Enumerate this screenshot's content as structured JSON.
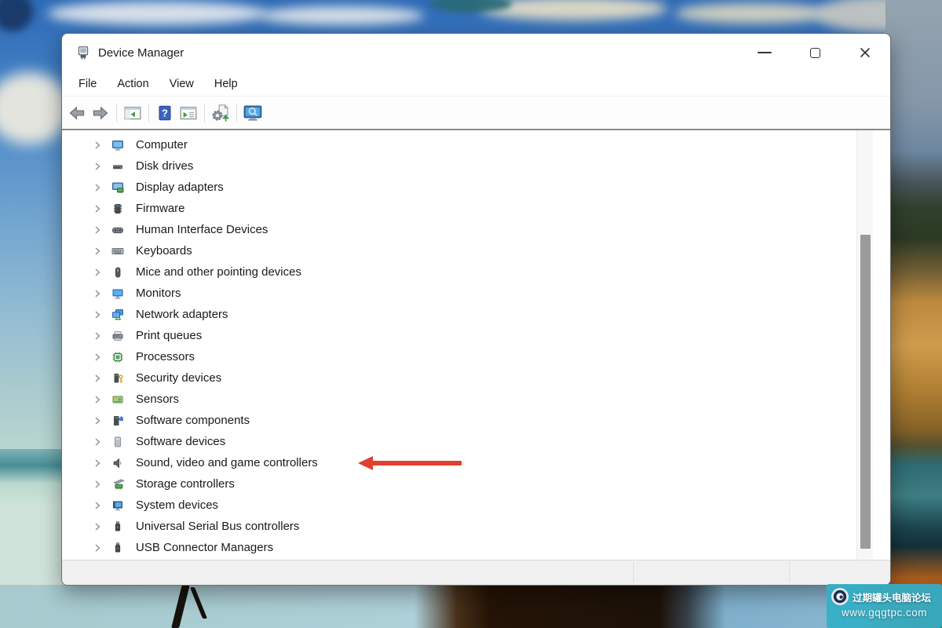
{
  "window": {
    "title": "Device Manager",
    "controls": [
      "minimize",
      "maximize",
      "close"
    ]
  },
  "menu_bar": {
    "items": [
      "File",
      "Action",
      "View",
      "Help"
    ]
  },
  "toolbar": {
    "groups": [
      [
        "back",
        "forward"
      ],
      [
        "show-hide-console-tree"
      ],
      [
        "help",
        "show-action-pane"
      ],
      [
        "scan-for-hardware-changes"
      ],
      [
        "search-computer"
      ]
    ]
  },
  "device_tree": {
    "items": [
      {
        "label": "Computer",
        "icon": "computer-icon"
      },
      {
        "label": "Disk drives",
        "icon": "disk-icon"
      },
      {
        "label": "Display adapters",
        "icon": "display-adapter-icon"
      },
      {
        "label": "Firmware",
        "icon": "firmware-icon"
      },
      {
        "label": "Human Interface Devices",
        "icon": "hid-icon"
      },
      {
        "label": "Keyboards",
        "icon": "keyboard-icon"
      },
      {
        "label": "Mice and other pointing devices",
        "icon": "mouse-icon"
      },
      {
        "label": "Monitors",
        "icon": "monitor-icon"
      },
      {
        "label": "Network adapters",
        "icon": "network-icon"
      },
      {
        "label": "Print queues",
        "icon": "printer-icon"
      },
      {
        "label": "Processors",
        "icon": "processor-icon"
      },
      {
        "label": "Security devices",
        "icon": "security-icon"
      },
      {
        "label": "Sensors",
        "icon": "sensor-icon"
      },
      {
        "label": "Software components",
        "icon": "software-component-icon"
      },
      {
        "label": "Software devices",
        "icon": "software-device-icon"
      },
      {
        "label": "Sound, video and game controllers",
        "icon": "speaker-icon"
      },
      {
        "label": "Storage controllers",
        "icon": "storage-icon"
      },
      {
        "label": "System devices",
        "icon": "system-icon"
      },
      {
        "label": "Universal Serial Bus controllers",
        "icon": "usb-icon"
      },
      {
        "label": "USB Connector Managers",
        "icon": "usb-icon"
      }
    ]
  },
  "annotation": {
    "arrow_color": "#e0402f",
    "points_to": "Sound, video and game controllers"
  },
  "watermark": {
    "title": "过期罐头电脑论坛",
    "url": "www.gqgtpc.com",
    "background": "#34afc7"
  }
}
